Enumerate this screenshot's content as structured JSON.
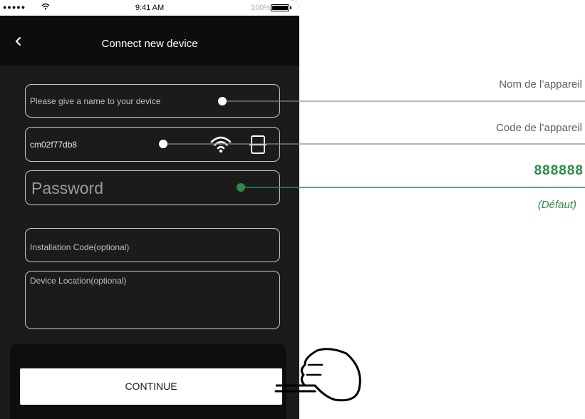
{
  "status_bar": {
    "signal": "●●●●●",
    "time": "9:41 AM",
    "battery": "100%"
  },
  "nav": {
    "title": "Connect new device"
  },
  "form": {
    "name_placeholder": "Please give a name to your device",
    "device_code": "cm02f77db8",
    "password_placeholder": "Password",
    "installation_code_placeholder": "Installation Code(optional)",
    "location_placeholder": "Device Location(optional)"
  },
  "continue_label": "CONTINUE",
  "annotations": {
    "name": "Nom de l’appareil",
    "code": "Code de l’appareil",
    "password": "888888",
    "password_note": "(Défaut)"
  },
  "colors": {
    "accent_green": "#2c8a4a",
    "annotation_gray": "#5f5f5f"
  },
  "icons": [
    "back-chevron-icon",
    "wifi-icon",
    "scan-frame-icon",
    "pointing-hand-icon"
  ]
}
